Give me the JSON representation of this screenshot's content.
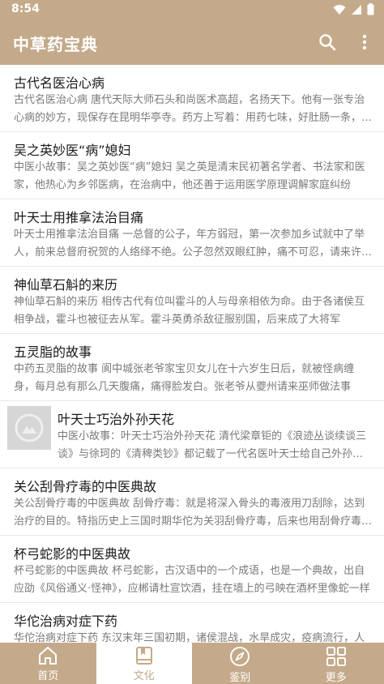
{
  "status": {
    "time": "8:54"
  },
  "app_bar": {
    "title": "中草药宝典"
  },
  "articles": [
    {
      "title": "古代名医治心病",
      "summary": "古代名医治心病 唐代天际大师石头和尚医术高超，名扬天下。他有一张专治心病的妙方，现保存在昆明华亭寺。药方上写着：用药七味，好肚肠一条，慈悲心一片，温柔半两，道理三分，信行要紧，中直一块，孝顺十分"
    },
    {
      "title": "吴之英妙医“病”媳妇",
      "summary": "中医小故事：吴之英妙医“病”媳妇 吴之英是清末民初著名学者、书法家和医家，他热心为乡邻医病，在治病中，他还善于运用医学原理调解家庭纠纷"
    },
    {
      "title": "叶天士用推拿法治目痛",
      "summary": "叶天士用推拿法治目痛 一总督的公子，年方弱冠，第一次参加乡试就中了举人，前来总督府祝贺的人络绎不绝。公子忽然双眼红肿，痛不可忍，请来许多名医"
    },
    {
      "title": "神仙草石斛的来历",
      "summary": "神仙草石斛的来历 相传古代有位叫霍斗的人与母亲相依为命。由于各诸侯互相争战，霍斗也被征去从军。霍斗英勇杀敌征服别国，后来成了大将军"
    },
    {
      "title": "五灵脂的故事",
      "summary": "中药五灵脂的故事 阆中城张老爷家宝贝女儿在十六岁生日后，就被怪病缠身，每月总有那么几天腹痛，痛得脸发白。张老爷从夔州请来巫师做法事"
    },
    {
      "title": "叶天士巧治外孙天花",
      "summary": "中医小故事：叶天士巧治外孙天花 清代梁章钜的《浪迹丛谈续谈三谈》与徐珂的《清稗类钞》都记载了一代名医叶天士给自己外孙治天花的故事",
      "has_thumb": true
    },
    {
      "title": "关公刮骨疗毒的中医典故",
      "summary": "关公刮骨疗毒的中医典故 刮骨疗毒：就是将深入骨头的毒液用刀刮除，达到治疗的目的。特指历史上三国时期华佗为关羽刮骨疗毒，后来也用刮骨疗毒比喻"
    },
    {
      "title": "杯弓蛇影的中医典故",
      "summary": "杯弓蛇影的中医典故 杯弓蛇影，古汉语中的一个成语，也是一个典故，出自应劭《风俗通义·怪神》，应郴请杜宣饮酒，挂在墙上的弓映在酒杯里像蛇一样"
    },
    {
      "title": "华佗治病对症下药",
      "summary": "华佗治病对症下药 东汉末年三国初期，诸侯混战，水旱成灾，疫病流行，人民处于水深火热之中"
    }
  ],
  "bottom_nav": [
    {
      "label": "首页",
      "icon": "home-icon"
    },
    {
      "label": "文化",
      "icon": "book-icon",
      "active": true
    },
    {
      "label": "鉴别",
      "icon": "compass-icon"
    },
    {
      "label": "更多",
      "icon": "grid-icon"
    }
  ],
  "colors": {
    "primary": "#c4aa8a",
    "title_text": "#1a1a1a",
    "summary_text": "#7a7a7a",
    "divider": "#e8e8e8"
  }
}
